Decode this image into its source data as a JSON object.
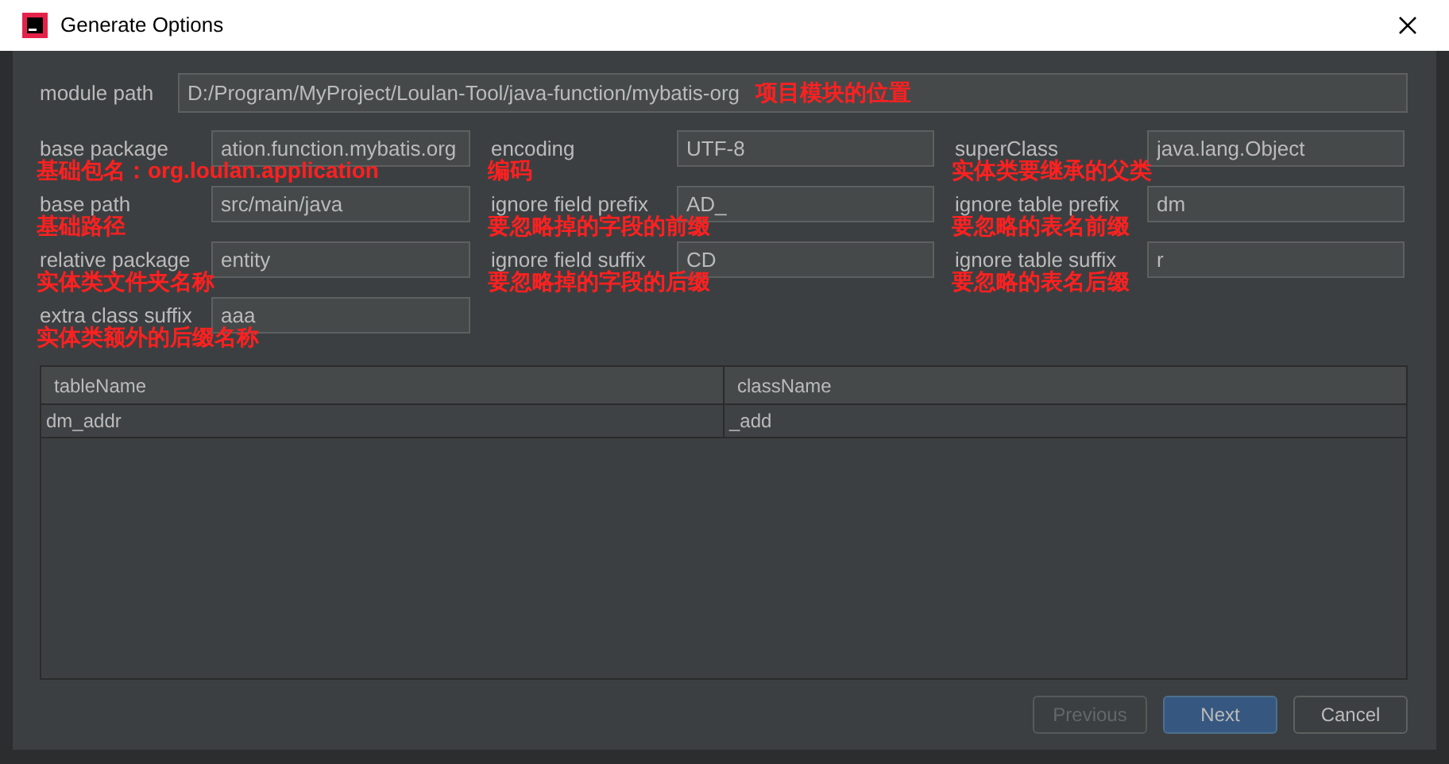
{
  "window": {
    "title": "Generate Options"
  },
  "module_path": {
    "label": "module path",
    "value": "D:/Program/MyProject/Loulan-Tool/java-function/mybatis-org",
    "note": "项目模块的位置"
  },
  "field_columns": [
    {
      "fields": [
        {
          "label": "base package",
          "value": "ation.function.mybatis.org",
          "note": "基础包名：org.loulan.application"
        },
        {
          "label": "base path",
          "value": "src/main/java",
          "note": "基础路径"
        },
        {
          "label": "relative package",
          "value": "entity",
          "note": "实体类文件夹名称"
        },
        {
          "label": "extra class suffix",
          "value": "aaa",
          "note": "实体类额外的后缀名称"
        }
      ]
    },
    {
      "fields": [
        {
          "label": "encoding",
          "value": "UTF-8",
          "note": "编码"
        },
        {
          "label": "ignore field prefix",
          "value": "AD_",
          "note": "要忽略掉的字段的前缀"
        },
        {
          "label": "ignore field suffix",
          "value": "CD",
          "note": "要忽略掉的字段的后缀"
        }
      ]
    },
    {
      "fields": [
        {
          "label": "superClass",
          "value": "java.lang.Object",
          "note": "实体类要继承的父类"
        },
        {
          "label": "ignore table prefix",
          "value": "dm",
          "note": "要忽略的表名前缀"
        },
        {
          "label": "ignore table suffix",
          "value": "r",
          "note": "要忽略的表名后缀"
        }
      ]
    }
  ],
  "table": {
    "columns": [
      "tableName",
      "className"
    ],
    "rows": [
      [
        "dm_addr",
        "_add"
      ]
    ]
  },
  "buttons": [
    {
      "label": "Previous",
      "kind": "default",
      "disabled": true
    },
    {
      "label": "Next",
      "kind": "primary",
      "disabled": false
    },
    {
      "label": "Cancel",
      "kind": "default",
      "disabled": false
    }
  ]
}
